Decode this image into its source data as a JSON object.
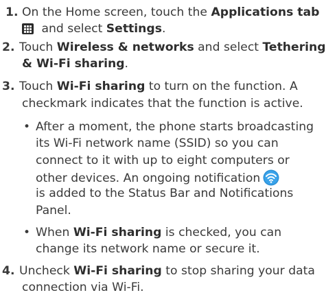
{
  "steps": [
    {
      "number": "1.",
      "line1_pre": "On the Home screen, touch the ",
      "line1_bold": "Applications tab",
      "line2_mid": " and select ",
      "line2_bold": "Settings",
      "line2_end": ".",
      "icon": "applications-grid-icon"
    },
    {
      "number": "2.",
      "line1_pre": "Touch ",
      "line1_bold1": "Wireless & networks",
      "line1_mid": " and select ",
      "line1_bold2": "Tethering",
      "line2_bold": "& Wi-Fi sharing",
      "line2_end": "."
    },
    {
      "number": "3.",
      "line1_pre": "Touch ",
      "line1_bold": "Wi-Fi sharing",
      "line1_end": " to turn on the function. A",
      "line2": "checkmark indicates that the function is active."
    },
    {
      "number": "4.",
      "line1_pre": "Uncheck ",
      "line1_bold": "Wi-Fi sharing",
      "line1_end": " to stop sharing your data",
      "line2": "connection via Wi-Fi."
    }
  ],
  "bullets": [
    {
      "symbol": "•",
      "lines": [
        "After a moment, the phone starts broadcasting",
        "its Wi-Fi network name (SSID) so you can",
        "connect to it with up to eight computers or",
        "other devices. An ongoing notification",
        "is added to the Status Bar and Notifications",
        "Panel."
      ],
      "icon": "wifi-notification-icon",
      "icon_color": "#2a8fd6"
    },
    {
      "symbol": "•",
      "line1_bold": "Wi-Fi sharing",
      "line1_pre": "When ",
      "line1_end": " is checked, you can",
      "line2": "change its network name or secure it."
    }
  ]
}
